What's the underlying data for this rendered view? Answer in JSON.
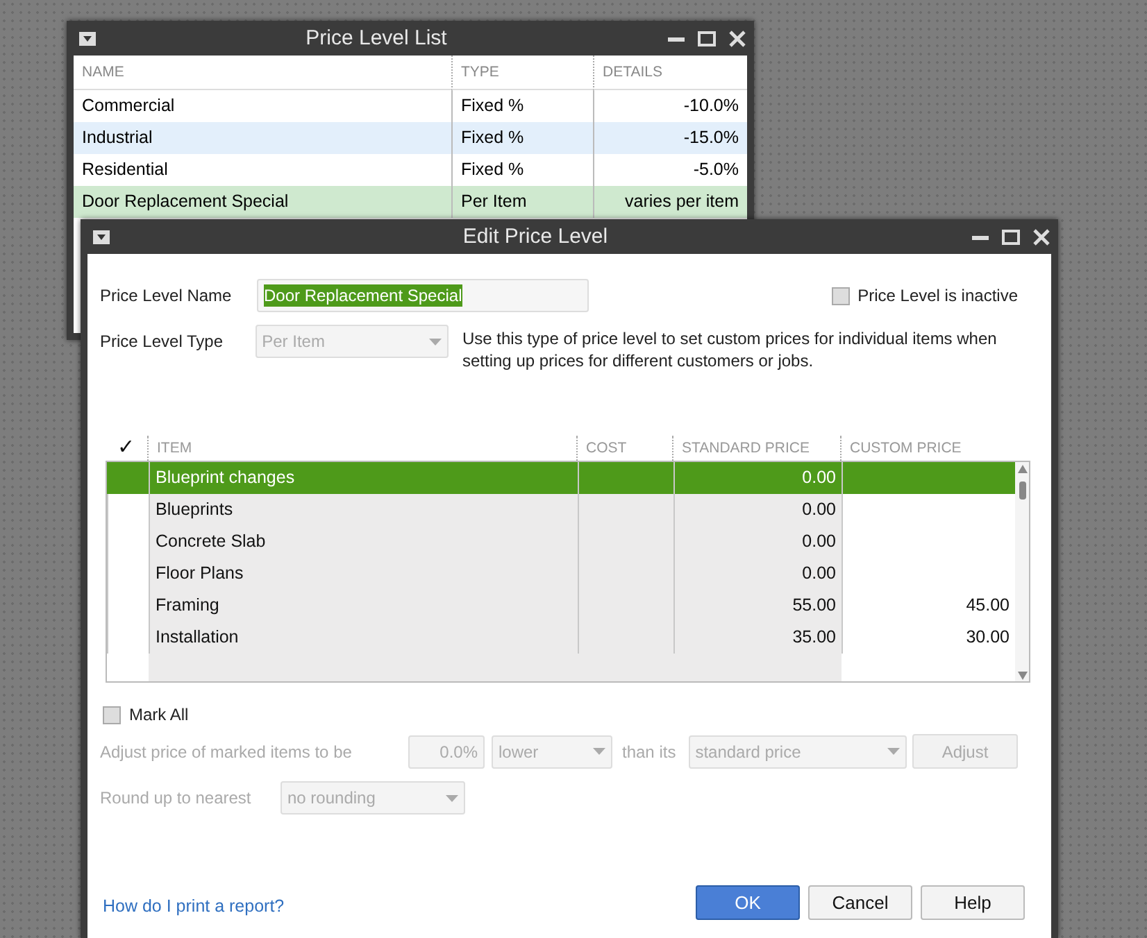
{
  "list_window": {
    "title": "Price Level List",
    "columns": [
      "NAME",
      "TYPE",
      "DETAILS"
    ],
    "rows": [
      {
        "name": "Commercial",
        "type": "Fixed %",
        "details": "-10.0%",
        "selected": false
      },
      {
        "name": "Industrial",
        "type": "Fixed %",
        "details": "-15.0%",
        "selected": false
      },
      {
        "name": "Residential",
        "type": "Fixed %",
        "details": "-5.0%",
        "selected": false
      },
      {
        "name": "Door Replacement Special",
        "type": "Per Item",
        "details": "varies per item",
        "selected": true
      }
    ]
  },
  "edit_window": {
    "title": "Edit Price Level",
    "name_label": "Price Level Name",
    "name_value": "Door Replacement Special",
    "inactive": {
      "label": "Price Level is inactive",
      "checked": false
    },
    "type_label": "Price Level Type",
    "type_value": "Per Item",
    "description": "Use this type of price level to set custom prices for individual items when setting up prices for different customers or jobs.",
    "table": {
      "check_header": "✓",
      "columns": [
        "ITEM",
        "COST",
        "STANDARD PRICE",
        "CUSTOM PRICE"
      ],
      "rows": [
        {
          "item": "Blueprint changes",
          "standard_price": "0.00",
          "selected": true
        },
        {
          "item": "Blueprints",
          "standard_price": "0.00",
          "selected": false
        },
        {
          "item": "Concrete Slab",
          "standard_price": "0.00",
          "selected": false
        },
        {
          "item": "Floor Plans",
          "standard_price": "0.00",
          "selected": false
        },
        {
          "item": "Framing",
          "standard_price": "55.00",
          "custom_price": "45.00",
          "selected": false
        },
        {
          "item": "Installation",
          "standard_price": "35.00",
          "custom_price": "30.00",
          "selected": false
        }
      ]
    },
    "mark_all": {
      "label": "Mark All",
      "checked": false
    },
    "adjust": {
      "label": "Adjust price of marked items to be",
      "percent": "0.0%",
      "direction": "lower",
      "than": "than its",
      "base": "standard price",
      "button": "Adjust"
    },
    "round": {
      "label": "Round up to nearest",
      "value": "no rounding"
    },
    "help_link": "How do I print a report?",
    "buttons": [
      {
        "label": "OK",
        "kind": "primary"
      },
      {
        "label": "Cancel",
        "kind": "normal"
      },
      {
        "label": "Help",
        "kind": "normal"
      }
    ]
  }
}
